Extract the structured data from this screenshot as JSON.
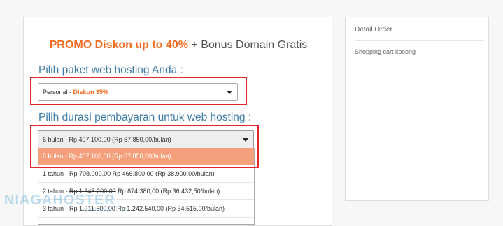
{
  "promo": {
    "highlight": "PROMO Diskon up to 40%",
    "rest": " + Bonus Domain Gratis"
  },
  "hosting": {
    "package_heading": "Pilih paket web hosting Anda :",
    "package_select": {
      "name": "Personal - ",
      "discount": "Diskon 35%"
    },
    "duration_heading": "Pilih durasi pembayaran untuk web hosting :",
    "duration_select": {
      "selected": "6 bulan - Rp 407.100,00 (Rp 67.850,00/bulan)"
    },
    "duration_options": [
      {
        "pre": "6 bulan - Rp 407.100,00 (Rp 67.850,00/bulan)",
        "old": "",
        "post": ""
      },
      {
        "pre": "1 tahun - ",
        "old": "Rp 708.000,00",
        "post": " Rp 466.800,00 (Rp 38.900,00/bulan)"
      },
      {
        "pre": "2 tahun - ",
        "old": "Rp 1.345.200,00",
        "post": " Rp 874.380,00 (Rp 36.432,50/bulan)"
      },
      {
        "pre": "3 tahun - ",
        "old": "Rp 1.911.600,00",
        "post": " Rp 1.242.540,00 (Rp 34.515,00/bulan)"
      }
    ]
  },
  "order": {
    "title": "Detail Order",
    "empty": "Shopping cart kosong"
  },
  "watermark": {
    "brand": "NIAGAHOSTER",
    "sub": "NIAGAHOSTER"
  },
  "colors": {
    "accent": "#f26b21",
    "heading": "#3f7ca8",
    "highlight_option": "#f4a07c",
    "annotation": "#e0252b"
  }
}
